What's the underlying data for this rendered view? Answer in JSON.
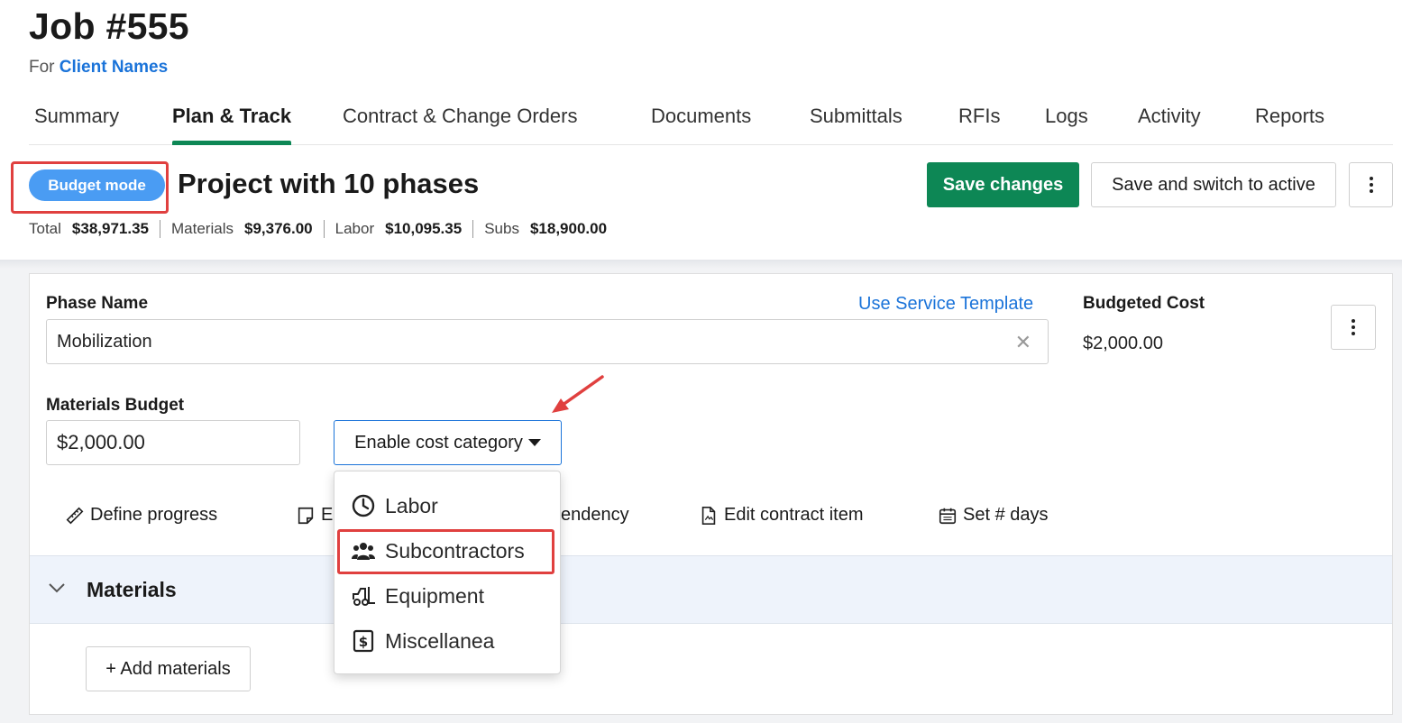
{
  "job": {
    "title": "Job #555",
    "for_prefix": "For",
    "client": "Client Names"
  },
  "tabs": [
    {
      "label": "Summary"
    },
    {
      "label": "Plan & Track"
    },
    {
      "label": "Contract & Change Orders"
    },
    {
      "label": "Documents"
    },
    {
      "label": "Submittals"
    },
    {
      "label": "RFIs"
    },
    {
      "label": "Logs"
    },
    {
      "label": "Activity"
    },
    {
      "label": "Reports"
    }
  ],
  "active_tab": "Plan & Track",
  "project": {
    "mode_badge": "Budget mode",
    "title": "Project with 10 phases",
    "save_label": "Save changes",
    "save_switch_label": "Save and switch to active"
  },
  "totals": [
    {
      "label": "Total",
      "value": "$38,971.35"
    },
    {
      "label": "Materials",
      "value": "$9,376.00"
    },
    {
      "label": "Labor",
      "value": "$10,095.35"
    },
    {
      "label": "Subs",
      "value": "$18,900.00"
    }
  ],
  "phase": {
    "name_label": "Phase Name",
    "template_link": "Use Service Template",
    "name_value": "Mobilization",
    "budgeted_cost_label": "Budgeted Cost",
    "budgeted_cost_value": "$2,000.00",
    "materials_budget_label": "Materials Budget",
    "materials_budget_value": "$2,000.00",
    "enable_cost_category_label": "Enable cost category"
  },
  "actions": [
    {
      "label": "Define progress"
    },
    {
      "label": "E"
    },
    {
      "label": "endency"
    },
    {
      "label": "Edit contract item"
    },
    {
      "label": "Set # days"
    }
  ],
  "cost_category_menu": [
    {
      "label": "Labor",
      "icon": "clock-icon"
    },
    {
      "label": "Subcontractors",
      "icon": "users-icon"
    },
    {
      "label": "Equipment",
      "icon": "forklift-icon"
    },
    {
      "label": "Miscellanea",
      "icon": "dollar-box-icon"
    }
  ],
  "materials_section": {
    "title": "Materials",
    "add_label": "+ Add materials"
  },
  "colors": {
    "accent_green": "#0d8755",
    "link_blue": "#1a73d9",
    "badge_blue": "#4a9cf3",
    "annotation_red": "#e0403f",
    "section_bg": "#eef3fb"
  }
}
